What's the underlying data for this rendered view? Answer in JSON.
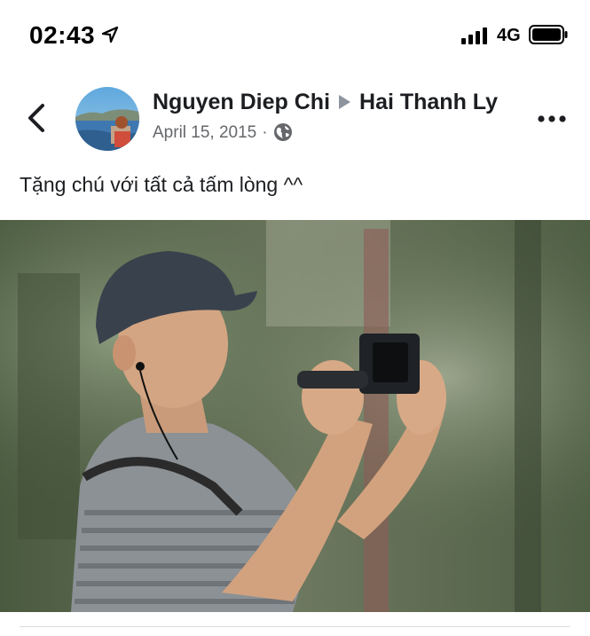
{
  "status_bar": {
    "time": "02:43",
    "location_icon": "location-arrow-icon",
    "signal_icon": "cellular-signal-icon",
    "network": "4G",
    "battery_icon": "battery-icon"
  },
  "post": {
    "back_icon": "chevron-left-icon",
    "author": "Nguyen Diep Chi",
    "target": "Hai Thanh Ly",
    "date": "April 15, 2015",
    "separator": "·",
    "privacy_icon": "globe-icon",
    "more_icon": "more-horizontal-icon",
    "caption": "Tặng chú với tất cả tấm lòng ^^"
  },
  "colors": {
    "text_primary": "#1c1e21",
    "text_secondary": "#65676b",
    "arrow": "#8d949e"
  }
}
